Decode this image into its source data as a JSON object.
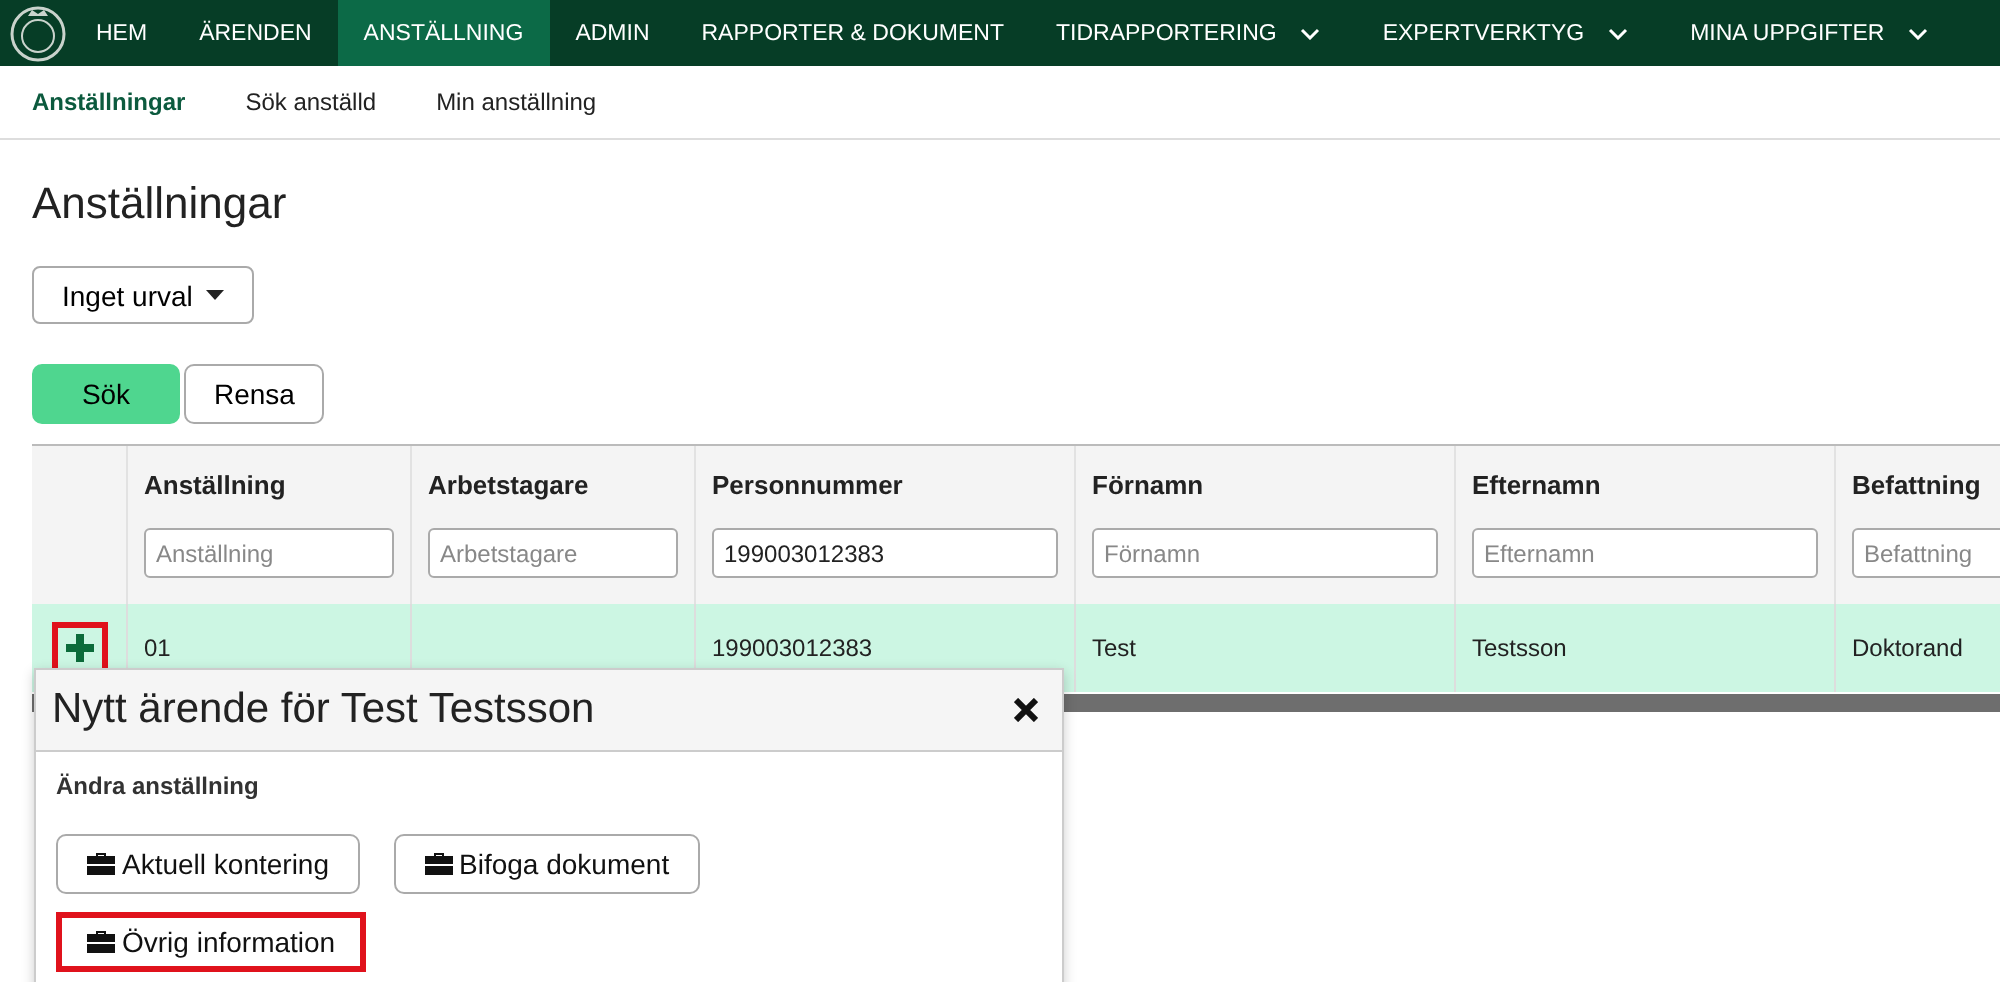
{
  "nav": {
    "items": [
      {
        "label": "HEM",
        "selected": false,
        "dropdown": false
      },
      {
        "label": "ÄRENDEN",
        "selected": false,
        "dropdown": false
      },
      {
        "label": "ANSTÄLLNING",
        "selected": true,
        "dropdown": false
      },
      {
        "label": "ADMIN",
        "selected": false,
        "dropdown": false
      },
      {
        "label": "RAPPORTER & DOKUMENT",
        "selected": false,
        "dropdown": false
      },
      {
        "label": "TIDRAPPORTERING",
        "selected": false,
        "dropdown": true
      },
      {
        "label": "EXPERTVERKTYG",
        "selected": false,
        "dropdown": true
      },
      {
        "label": "MINA UPPGIFTER",
        "selected": false,
        "dropdown": true
      }
    ]
  },
  "subnav": {
    "items": [
      {
        "label": "Anställningar",
        "selected": true
      },
      {
        "label": "Sök anställd",
        "selected": false
      },
      {
        "label": "Min anställning",
        "selected": false
      }
    ]
  },
  "page_title": "Anställningar",
  "filter_dropdown": "Inget urval",
  "buttons": [
    {
      "label": "Sök",
      "kind": "primary"
    },
    {
      "label": "Rensa",
      "kind": "secondary"
    }
  ],
  "table": {
    "columns": [
      {
        "title": "Anställning",
        "placeholder": "Anställning"
      },
      {
        "title": "Arbetstagare",
        "placeholder": "Arbetstagare"
      },
      {
        "title": "Personnummer",
        "value": "199003012383"
      },
      {
        "title": "Förnamn",
        "placeholder": "Förnamn"
      },
      {
        "title": "Efternamn",
        "placeholder": "Efternamn"
      },
      {
        "title": "Befattning",
        "placeholder": "Befattning"
      }
    ],
    "rows": [
      {
        "add_highlighted": true,
        "selected": true,
        "cells": [
          "01",
          "",
          "199003012383",
          "Test",
          "Testsson",
          "Doktorand"
        ]
      }
    ]
  },
  "popup": {
    "title": "Nytt ärende för Test Testsson",
    "section": "Ändra anställning",
    "actions": [
      {
        "label": "Aktuell kontering",
        "highlighted": false
      },
      {
        "label": "Bifoga dokument",
        "highlighted": false
      },
      {
        "label": "Övrig information",
        "highlighted": true
      }
    ]
  }
}
